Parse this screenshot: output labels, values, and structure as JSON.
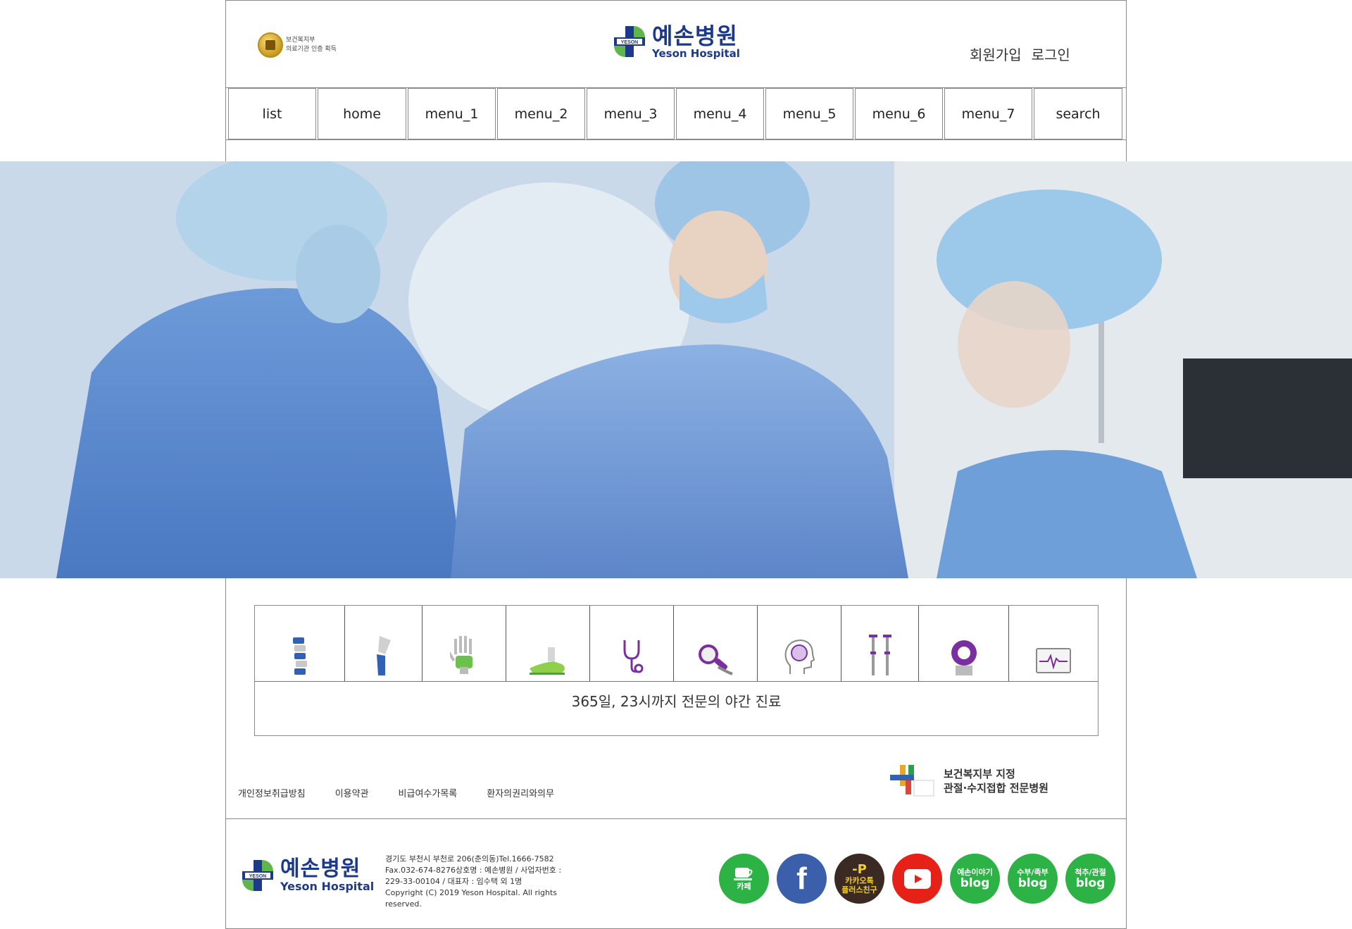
{
  "header": {
    "cert_line1": "보건복지부",
    "cert_line2": "의료기관 인증 획득",
    "logo_badge": "YESON",
    "logo_ko": "예손병원",
    "logo_en": "Yeson Hospital",
    "signup": "회원가입",
    "login": "로그인"
  },
  "nav": {
    "items": [
      "list",
      "home",
      "menu_1",
      "menu_2",
      "menu_3",
      "menu_4",
      "menu_5",
      "menu_6",
      "menu_7",
      "search"
    ]
  },
  "services": {
    "icons": [
      "spine-icon",
      "knee-icon",
      "hand-icon",
      "foot-icon",
      "stethoscope-icon",
      "magnifier-icon",
      "brain-icon",
      "crutches-icon",
      "mri-icon",
      "monitor-icon"
    ],
    "night_clinic": "365일, 23시까지 전문의 야간 진료"
  },
  "footer": {
    "links": [
      "개인정보취급방침",
      "이용약관",
      "비급여수가목록",
      "환자의권리와의무"
    ],
    "spec_line1": "보건복지부 지정",
    "spec_line2": "관절·수지접합 전문병원",
    "logo_badge": "YESON",
    "logo_ko": "예손병원",
    "logo_en": "Yeson Hospital",
    "address_lines": [
      "경기도 부천시 부천로 206(춘의동)Tel.1666-7582",
      "Fax.032-674-8276상호명 : 예손병원 / 사업자번호 :",
      "229-33-00104 / 대표자 : 임수택 외 1명",
      "Copyright (C) 2019 Yeson Hospital. All rights reserved."
    ],
    "social": [
      {
        "name": "cafe",
        "line1": "",
        "line2": "카페",
        "color": "#2db245"
      },
      {
        "name": "facebook",
        "line1": "",
        "line2": "f",
        "color": "#3b5fab"
      },
      {
        "name": "kakao",
        "line1": "카카오톡",
        "line2": "플러스친구",
        "color": "#3b2a24"
      },
      {
        "name": "youtube",
        "line1": "",
        "line2": "",
        "color": "#e62117"
      },
      {
        "name": "blog-story",
        "line1": "예손이야기",
        "line2": "blog",
        "color": "#2db245"
      },
      {
        "name": "blog-hand",
        "line1": "수부/족부",
        "line2": "blog",
        "color": "#2db245"
      },
      {
        "name": "blog-spine",
        "line1": "척추/관절",
        "line2": "blog",
        "color": "#2db245"
      }
    ]
  }
}
